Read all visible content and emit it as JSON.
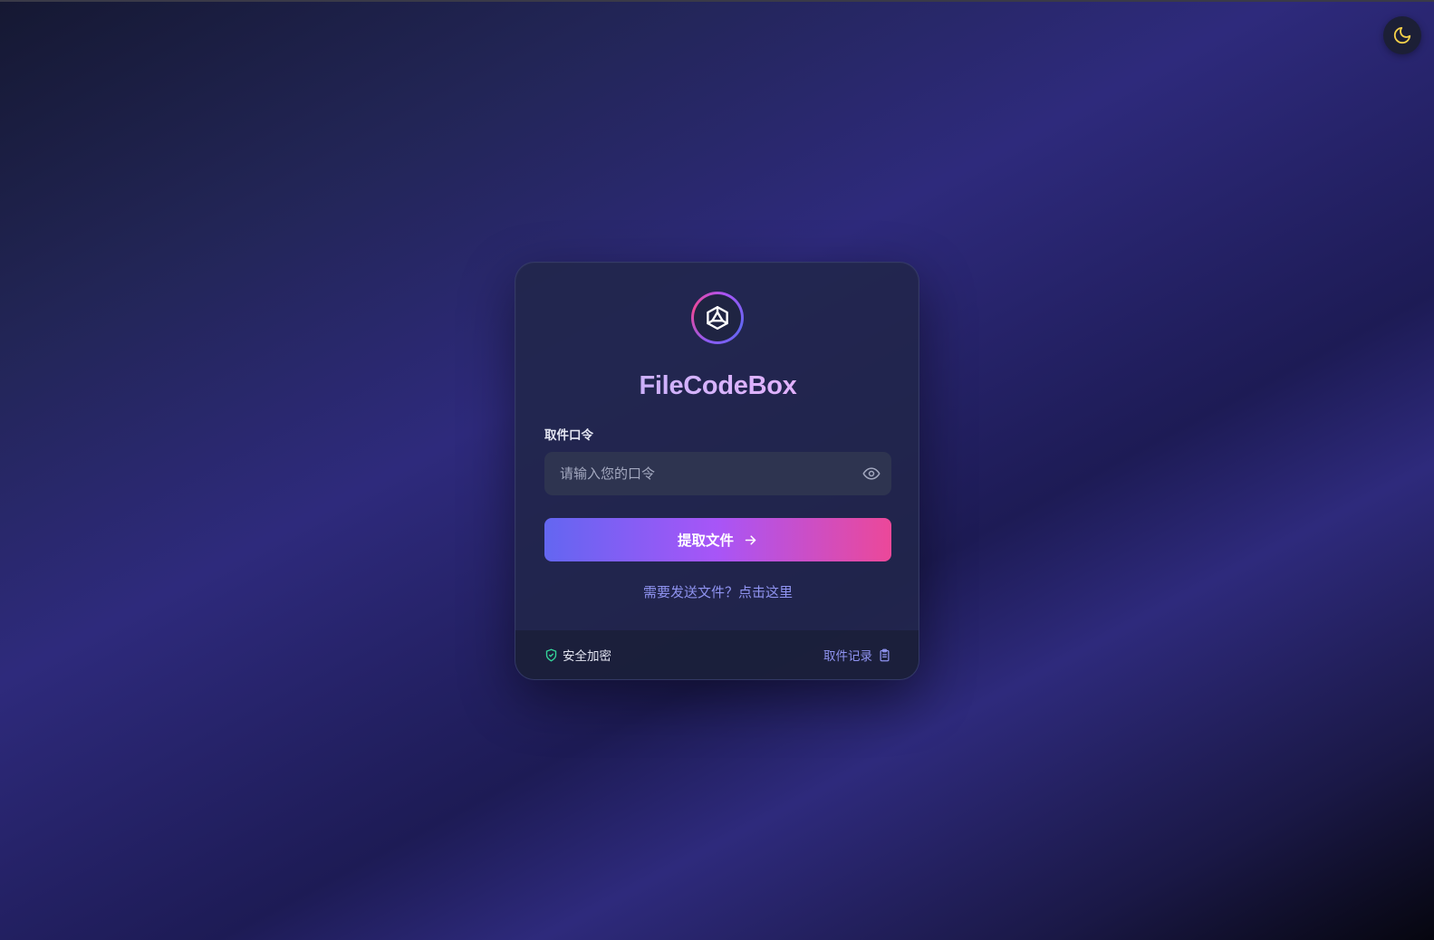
{
  "app": {
    "title": "FileCodeBox"
  },
  "theme_toggle": {
    "icon": "moon-icon",
    "icon_color": "#f5d04a"
  },
  "form": {
    "label": "取件口令",
    "input_placeholder": "请输入您的口令",
    "input_value": "",
    "visibility_icon": "eye-icon",
    "submit_label": "提取文件",
    "submit_icon": "arrow-right-icon"
  },
  "send_link": "需要发送文件？点击这里",
  "footer": {
    "secure_label": "安全加密",
    "secure_icon": "shield-check-icon",
    "secure_icon_color": "#34d399",
    "records_label": "取件记录",
    "records_icon": "clipboard-icon"
  },
  "colors": {
    "accent_start": "#6366f1",
    "accent_mid": "#a855f7",
    "accent_end": "#ec4899",
    "link": "#8f93f0"
  }
}
